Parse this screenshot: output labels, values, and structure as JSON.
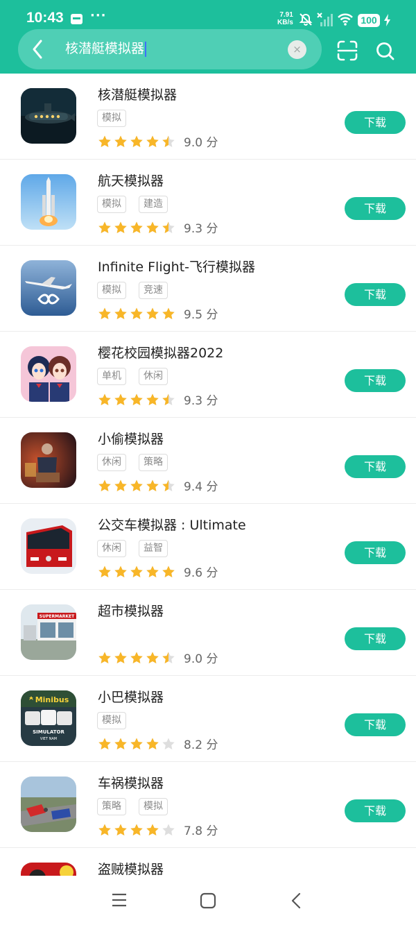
{
  "status_bar": {
    "time": "10:43",
    "more_dots": "···",
    "net_speed_value": "7.91",
    "net_speed_unit": "KB/s",
    "battery": "100"
  },
  "search": {
    "query": "核潜艇模拟器",
    "clear_glyph": "×"
  },
  "colors": {
    "accent": "#1dbf9c",
    "star": "#f8b628",
    "star_empty": "#dedede"
  },
  "apps": [
    {
      "name": "核潜艇模拟器",
      "tags": [
        "模拟"
      ],
      "stars": 4.5,
      "score": "9.0 分",
      "icon": "submarine-app-icon",
      "button": "下载"
    },
    {
      "name": "航天模拟器",
      "tags": [
        "模拟",
        "建造"
      ],
      "stars": 4.5,
      "score": "9.3 分",
      "icon": "rocket-app-icon",
      "button": "下载"
    },
    {
      "name": "Infinite Flight-飞行模拟器",
      "tags": [
        "模拟",
        "竞速"
      ],
      "stars": 5,
      "score": "9.5 分",
      "icon": "airplane-app-icon",
      "button": "下载"
    },
    {
      "name": "樱花校园模拟器2022",
      "tags": [
        "单机",
        "休闲"
      ],
      "stars": 4.5,
      "score": "9.3 分",
      "icon": "anime-school-app-icon",
      "button": "下载"
    },
    {
      "name": "小偷模拟器",
      "tags": [
        "休闲",
        "策略"
      ],
      "stars": 4.5,
      "score": "9.4 分",
      "icon": "thief-app-icon",
      "button": "下载"
    },
    {
      "name": "公交车模拟器 : Ultimate",
      "tags": [
        "休闲",
        "益智"
      ],
      "stars": 5,
      "score": "9.6 分",
      "icon": "bus-app-icon",
      "button": "下载"
    },
    {
      "name": "超市模拟器",
      "tags": [],
      "stars": 4.5,
      "score": "9.0 分",
      "icon": "supermarket-app-icon",
      "button": "下载"
    },
    {
      "name": "小巴模拟器",
      "tags": [
        "模拟"
      ],
      "stars": 4,
      "score": "8.2 分",
      "icon": "minibus-app-icon",
      "button": "下载",
      "icon_text": "Minibus",
      "icon_subtext": "SIMULATOR",
      "icon_subtext2": "VIET NAM"
    },
    {
      "name": "车祸模拟器",
      "tags": [
        "策略",
        "模拟"
      ],
      "stars": 4,
      "score": "7.8 分",
      "icon": "car-crash-app-icon",
      "button": "下载"
    },
    {
      "name": "盗贼模拟器",
      "tags": [],
      "stars": 0,
      "score": "",
      "icon": "robber-app-icon",
      "button": ""
    }
  ],
  "supermarket_sign": "SUPERMARKET"
}
